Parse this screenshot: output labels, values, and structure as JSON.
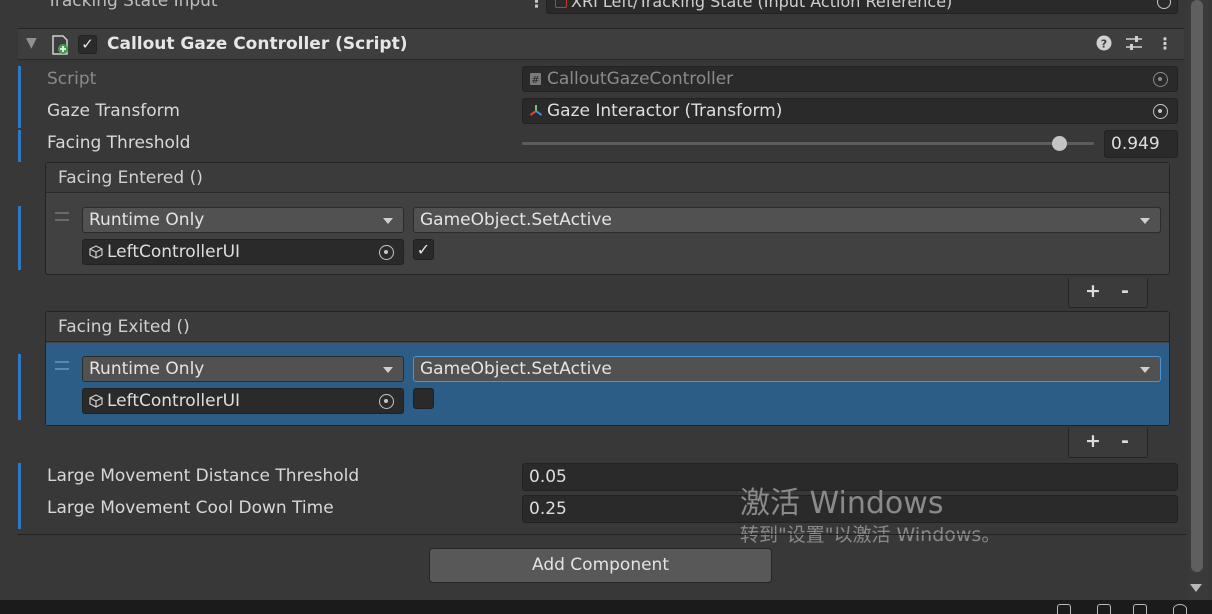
{
  "prev_row": {
    "label": "Tracking State Input",
    "field_value": "XRI Left/Tracking State (Input Action Reference)"
  },
  "component": {
    "title": "Callout Gaze Controller (Script)",
    "enabled_mark": "✓"
  },
  "properties": {
    "script": {
      "label": "Script",
      "value": "CalloutGazeController"
    },
    "gaze_transform": {
      "label": "Gaze Transform",
      "value": "Gaze Interactor (Transform)"
    },
    "facing_threshold": {
      "label": "Facing Threshold",
      "value": "0.949",
      "slider_fraction": 0.94
    }
  },
  "events": {
    "facing_entered": {
      "header": "Facing Entered ()",
      "call_state": "Runtime Only",
      "function": "GameObject.SetActive",
      "target": "LeftControllerUI",
      "checked_mark": "✓",
      "plus": "+",
      "minus": "-"
    },
    "facing_exited": {
      "header": "Facing Exited ()",
      "call_state": "Runtime Only",
      "function": "GameObject.SetActive",
      "target": "LeftControllerUI",
      "checked_mark": "",
      "plus": "+",
      "minus": "-"
    }
  },
  "more_properties": {
    "distance_threshold": {
      "label": "Large Movement Distance Threshold",
      "value": "0.05"
    },
    "cool_down_time": {
      "label": "Large Movement Cool Down Time",
      "value": "0.25"
    }
  },
  "add_component": "Add Component",
  "watermark": {
    "line1": "激活 Windows",
    "line2": "转到\"设置\"以激活 Windows。"
  },
  "colors": {
    "accent_blue": "#2f78c2",
    "selected_row": "#2c5d87",
    "background": "#383838"
  }
}
